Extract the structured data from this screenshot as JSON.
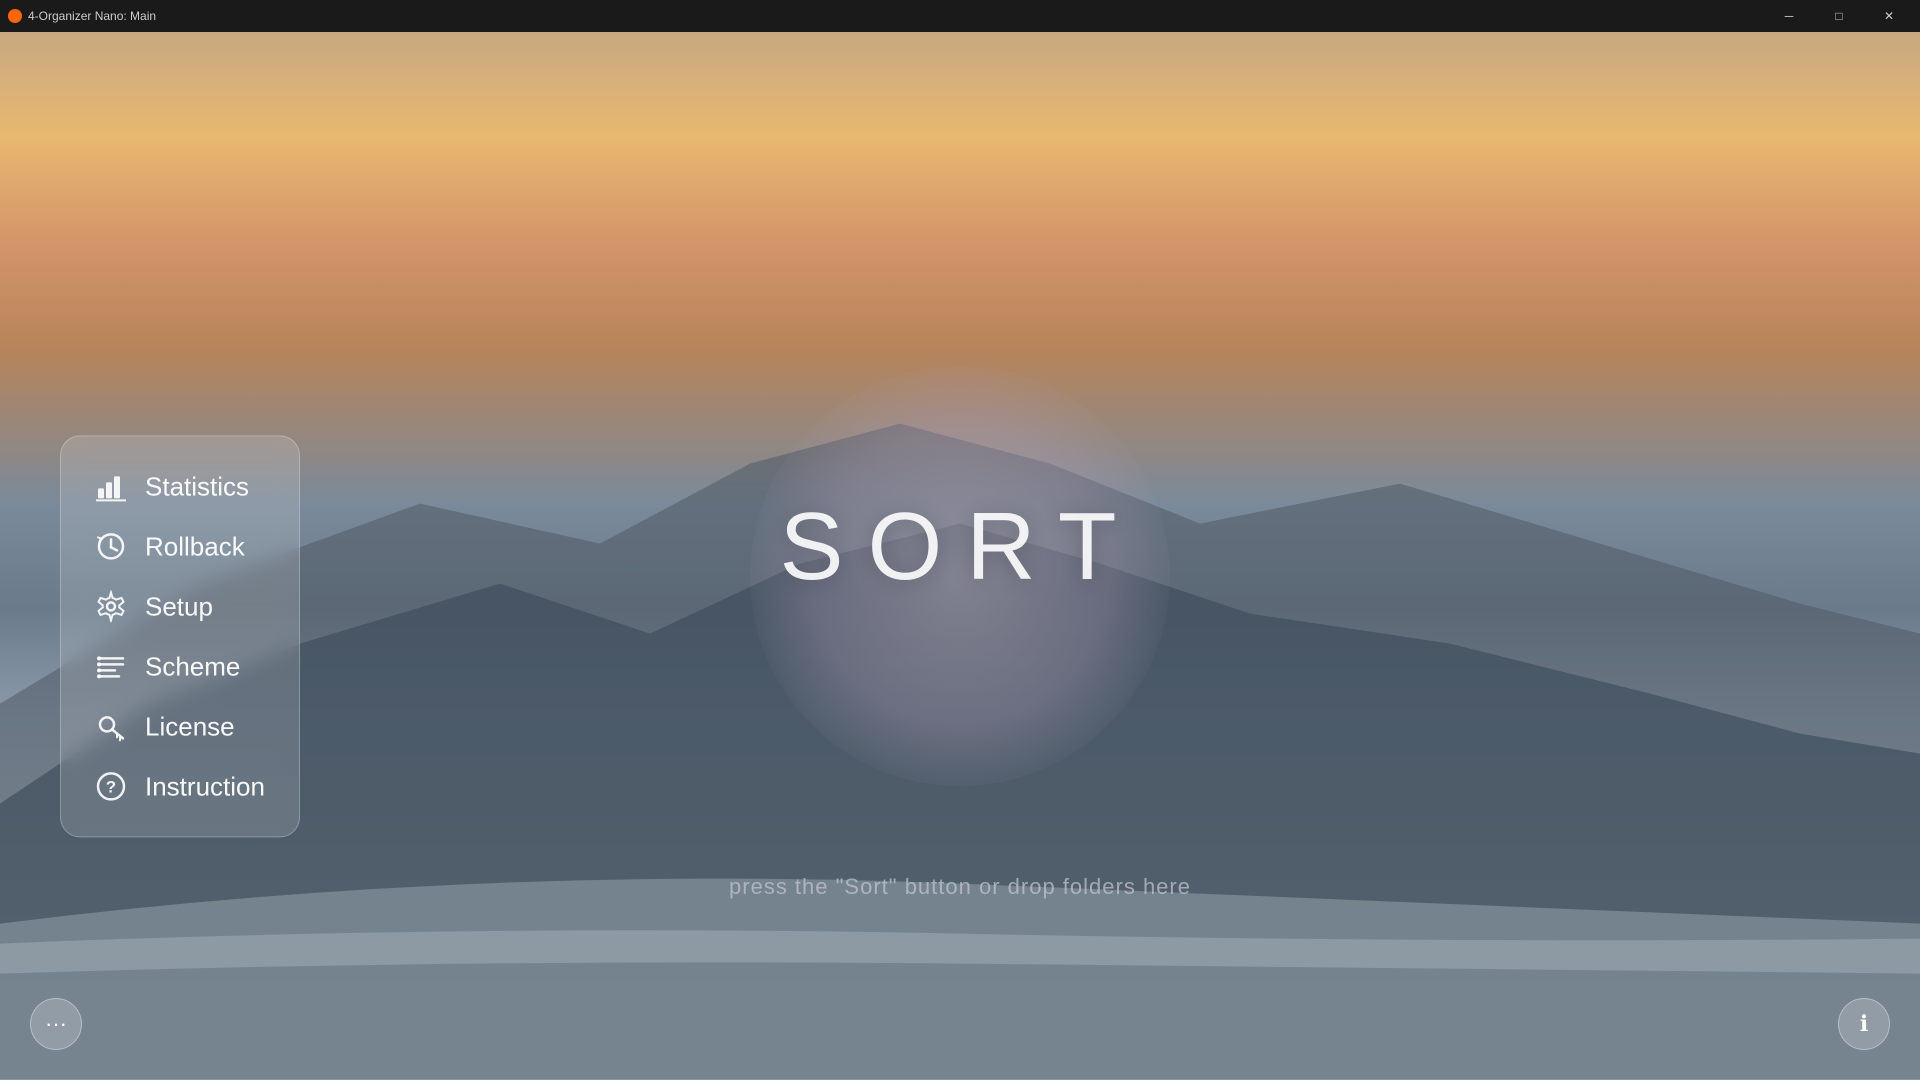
{
  "titlebar": {
    "title": "4-Organizer Nano: Main",
    "minimize_label": "─",
    "restore_label": "□",
    "close_label": "✕"
  },
  "main": {
    "sort_label": "SORT",
    "hint_text": "press the \"Sort\" button or drop folders here"
  },
  "menu": {
    "items": [
      {
        "id": "statistics",
        "label": "Statistics",
        "icon": "bar-chart-icon"
      },
      {
        "id": "rollback",
        "label": "Rollback",
        "icon": "clock-icon"
      },
      {
        "id": "setup",
        "label": "Setup",
        "icon": "gear-icon"
      },
      {
        "id": "scheme",
        "label": "Scheme",
        "icon": "list-icon"
      },
      {
        "id": "license",
        "label": "License",
        "icon": "key-icon"
      },
      {
        "id": "instruction",
        "label": "Instruction",
        "icon": "help-icon"
      }
    ]
  },
  "more_button": {
    "label": "···"
  },
  "info_button": {
    "label": "ℹ"
  }
}
